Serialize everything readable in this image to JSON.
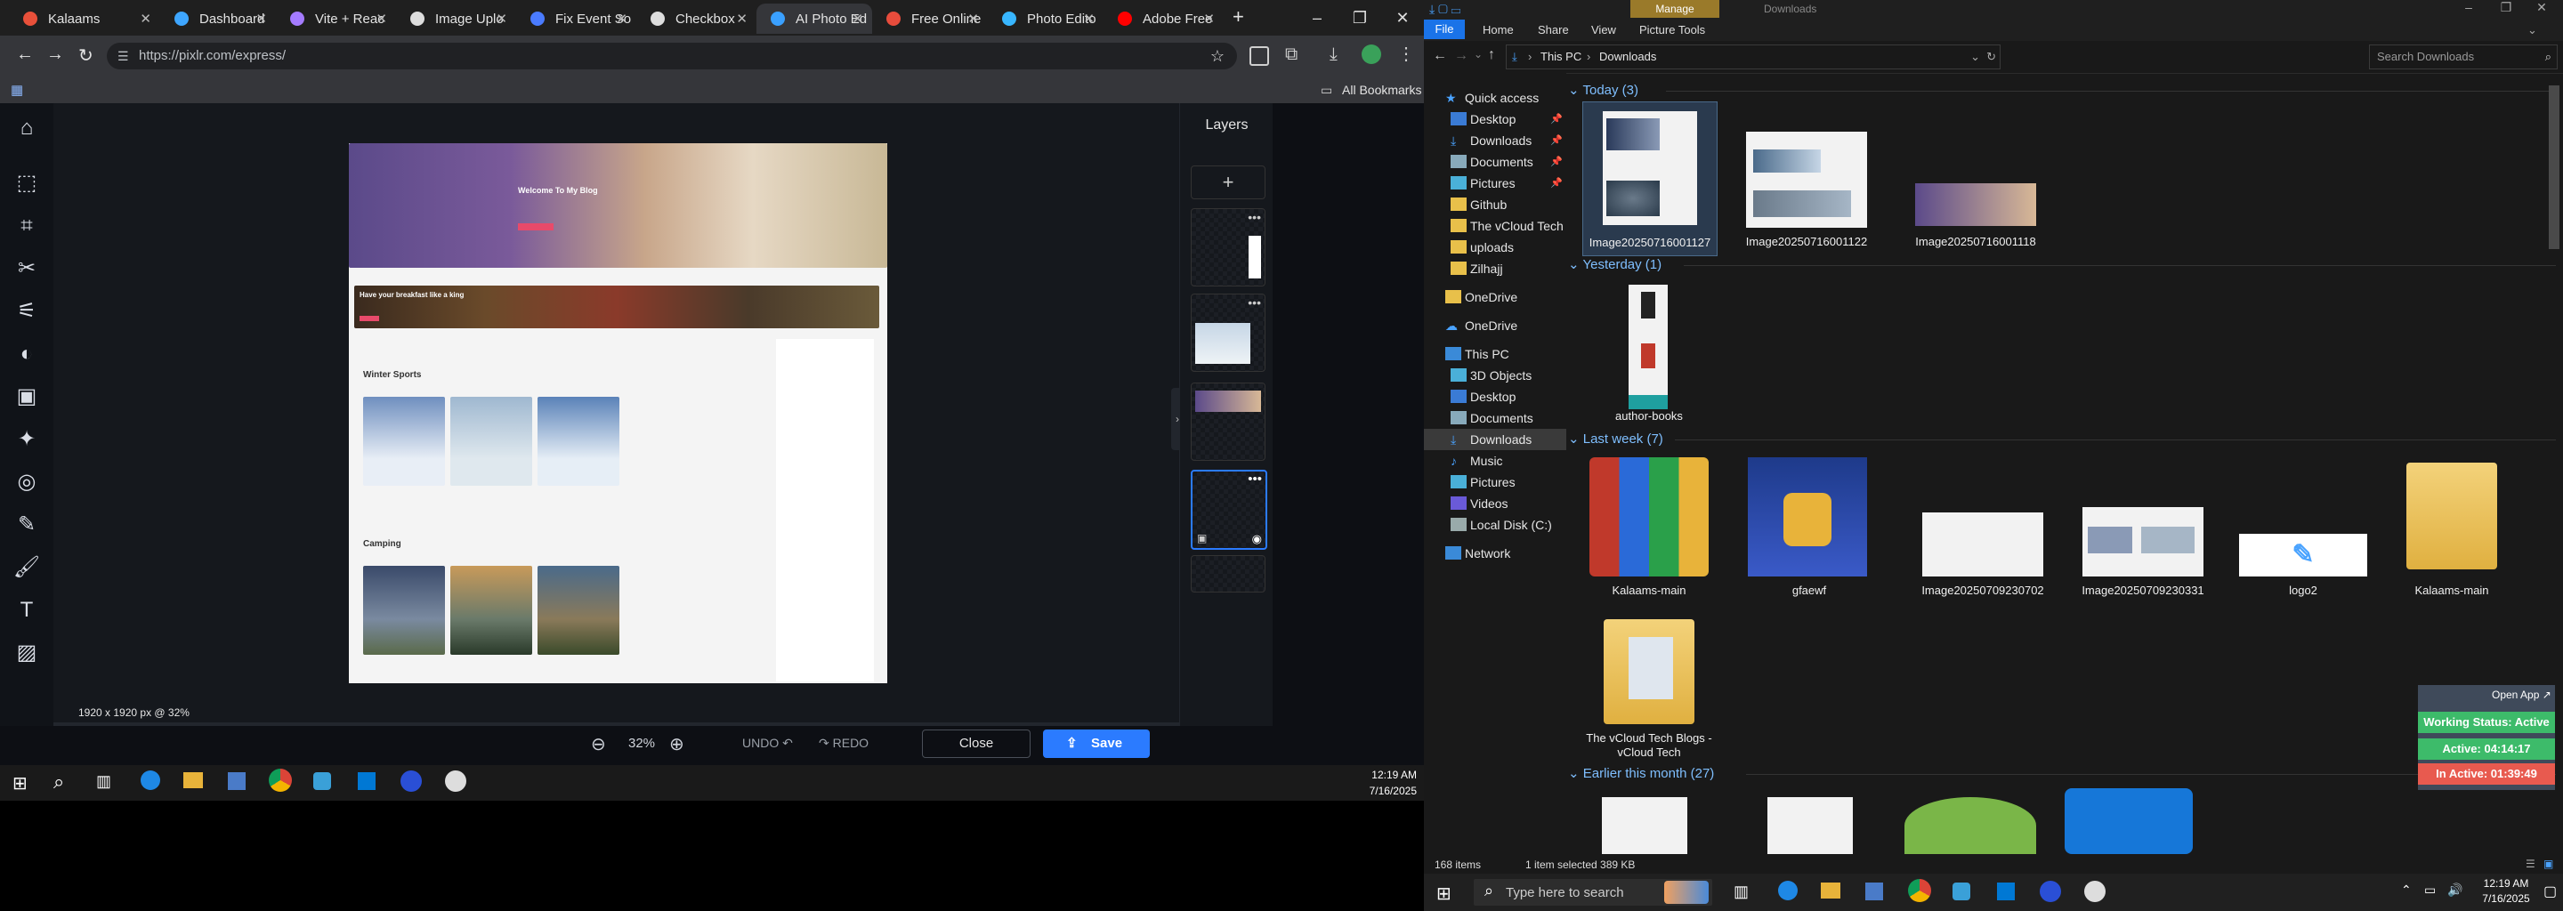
{
  "chrome": {
    "tabs": [
      {
        "label": "Kalaams",
        "color": "#e8503a"
      },
      {
        "label": "Dashboard",
        "color": "#3ea6ff"
      },
      {
        "label": "Vite + Reac",
        "color": "#a47bff"
      },
      {
        "label": "Image Uplo",
        "color": "#dddddd"
      },
      {
        "label": "Fix Event So",
        "color": "#4a7bff"
      },
      {
        "label": "Checkbox",
        "color": "#dddddd"
      },
      {
        "label": "AI Photo Ed",
        "color": "#3aa0ff"
      },
      {
        "label": "Free Online",
        "color": "#e74c3c"
      },
      {
        "label": "Photo Edito",
        "color": "#38b6ff"
      },
      {
        "label": "Adobe Free",
        "color": "#ff0000"
      }
    ],
    "new_tab": "+",
    "url": "https://pixlr.com/express/",
    "all_bookmarks": "All Bookmarks",
    "window_controls": [
      "–",
      "❐",
      "✕"
    ]
  },
  "pixlr": {
    "layers_title": "Layers",
    "add_layer": "+",
    "size_info": "1920 x 1920 px @ 32%",
    "zoom": "32%",
    "undo": "UNDO",
    "redo": "REDO",
    "close": "Close",
    "save": "Save",
    "tools": [
      "home",
      "arrange",
      "crop",
      "cutout",
      "adjust",
      "filter",
      "effect",
      "retouch",
      "liquify",
      "draw",
      "paint",
      "text",
      "pattern"
    ],
    "blog": {
      "hero_title": "Welcome To My Blog",
      "banner_title": "Have your breakfast like a king",
      "section1": "Winter Sports",
      "section2": "Camping"
    }
  },
  "taskbar_left": {
    "time": "12:19 AM",
    "date": "7/16/2025"
  },
  "explorer": {
    "ribbon_tabs": [
      "File",
      "Home",
      "Share",
      "View",
      "Picture Tools"
    ],
    "manage": "Manage",
    "title": "Downloads",
    "breadcrumb": [
      "This PC",
      "Downloads"
    ],
    "search_placeholder": "Search Downloads",
    "nav": {
      "quick_access": "Quick access",
      "quick_items": [
        "Desktop",
        "Downloads",
        "Documents",
        "Pictures",
        "Github",
        "The vCloud Tech Blo",
        "uploads",
        "Zilhajj"
      ],
      "onedrive1": "OneDrive",
      "onedrive2": "OneDrive",
      "this_pc": "This PC",
      "pc_items": [
        "3D Objects",
        "Desktop",
        "Documents",
        "Downloads",
        "Music",
        "Pictures",
        "Videos",
        "Local Disk (C:)"
      ],
      "network": "Network"
    },
    "groups": {
      "today": "Today (3)",
      "yesterday": "Yesterday (1)",
      "last_week": "Last week (7)",
      "earlier": "Earlier this month (27)"
    },
    "files_today": [
      "Image20250716001127",
      "Image20250716001122",
      "Image20250716001118"
    ],
    "files_yesterday": [
      "author-books"
    ],
    "files_last_week": [
      "Kalaams-main",
      "gfaewf",
      "Image20250709230702",
      "Image20250709230331",
      "logo2",
      "Kalaams-main",
      "The vCloud Tech Blogs - vCloud Tech"
    ],
    "status_items": "168 items",
    "status_selected": "1 item selected  389 KB"
  },
  "widget": {
    "open_app": "Open App ↗",
    "working_status": "Working Status: Active",
    "active": "Active: 04:14:17",
    "inactive": "In Active: 01:39:49",
    "colors": {
      "green": "#3dbb6a",
      "red": "#e85a4f",
      "blue": "#3f4a5a"
    }
  },
  "taskbar_right": {
    "search_placeholder": "Type here to search",
    "time": "12:19 AM",
    "date": "7/16/2025"
  }
}
